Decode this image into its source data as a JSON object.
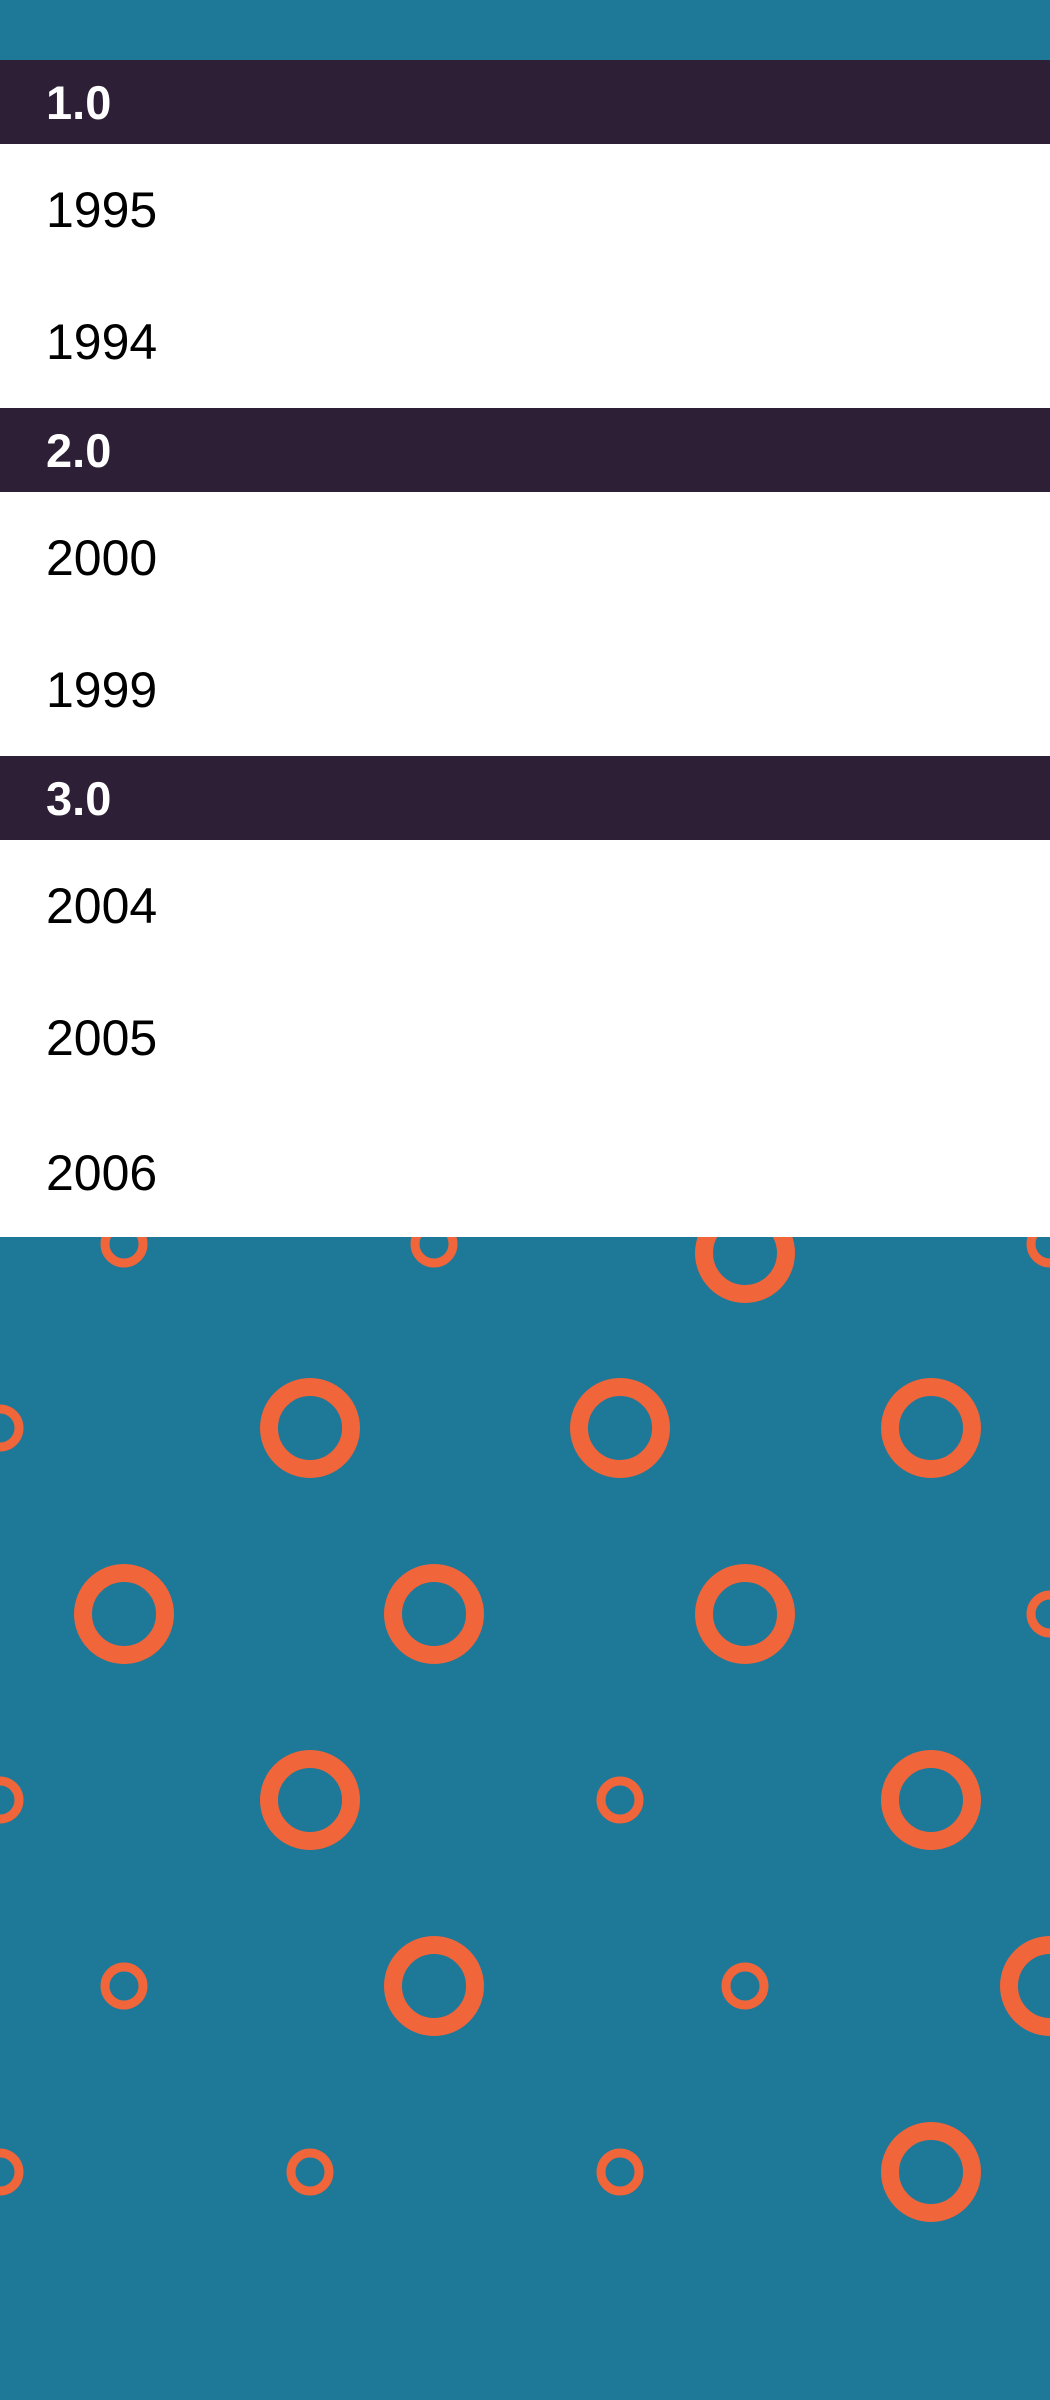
{
  "sections": [
    {
      "header": "1.0",
      "items": [
        "1995",
        "1994"
      ]
    },
    {
      "header": "2.0",
      "items": [
        "2000",
        "1999"
      ]
    },
    {
      "header": "3.0",
      "items": [
        "2004",
        "2005",
        "2006"
      ]
    }
  ],
  "colors": {
    "background": "#1e7898",
    "header_background": "#2c1f36",
    "header_text": "#ffffff",
    "list_background": "#ffffff",
    "ring": "#f0653a"
  },
  "background_pattern": "orange-ring-pattern"
}
